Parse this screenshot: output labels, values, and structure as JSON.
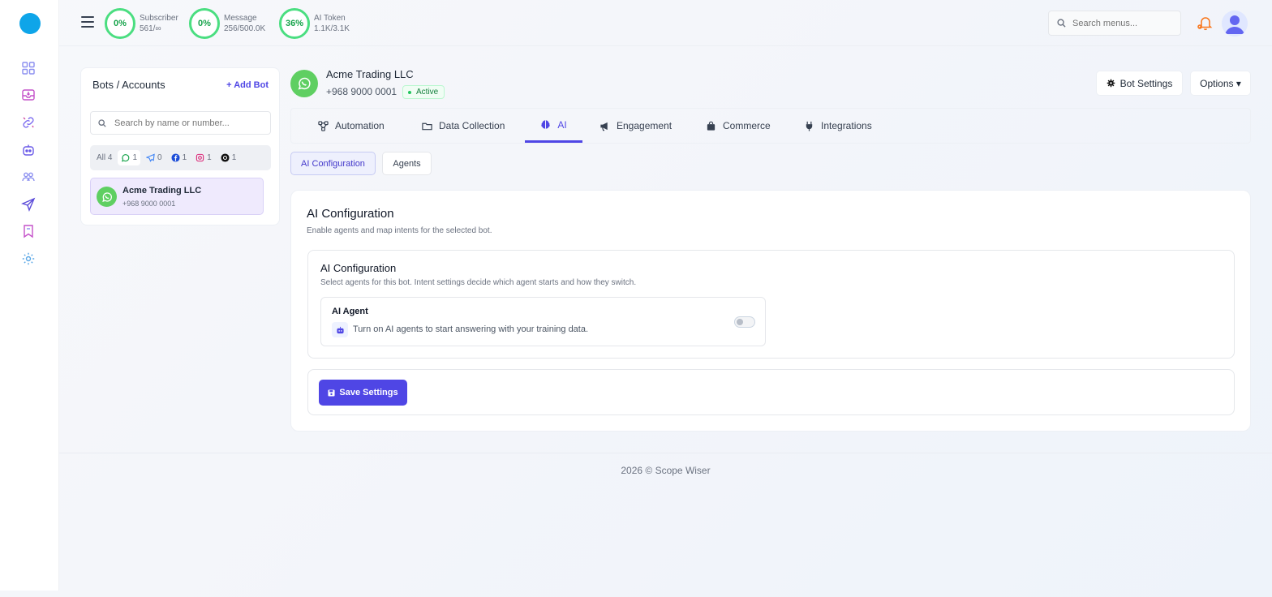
{
  "topbar": {
    "stats": [
      {
        "percent": "0%",
        "label": "Subscriber",
        "value": "561/∞"
      },
      {
        "percent": "0%",
        "label": "Message",
        "value": "256/500.0K"
      },
      {
        "percent": "36%",
        "label": "AI Token",
        "value": "1.1K/3.1K"
      }
    ],
    "search_placeholder": "Search menus..."
  },
  "bots_panel": {
    "title": "Bots / Accounts",
    "add_label": "+ Add Bot",
    "search_placeholder": "Search by name or number...",
    "filters": {
      "all": "All 4",
      "whatsapp": "1",
      "telegram": "0",
      "facebook": "1",
      "instagram": "1",
      "threads": "1"
    },
    "items": [
      {
        "name": "Acme Trading LLC",
        "phone": "+968 9000 0001"
      }
    ]
  },
  "bot_header": {
    "name": "Acme Trading LLC",
    "phone": "+968 9000 0001",
    "status": "Active",
    "bot_settings_label": "Bot Settings",
    "options_label": "Options ▾"
  },
  "tabs": [
    {
      "label": "Automation",
      "icon": "flow-icon"
    },
    {
      "label": "Data Collection",
      "icon": "folder-icon"
    },
    {
      "label": "AI",
      "icon": "brain-icon",
      "active": true
    },
    {
      "label": "Engagement",
      "icon": "megaphone-icon"
    },
    {
      "label": "Commerce",
      "icon": "bag-icon"
    },
    {
      "label": "Integrations",
      "icon": "plug-icon"
    }
  ],
  "subtabs": [
    {
      "label": "AI Configuration",
      "active": true
    },
    {
      "label": "Agents"
    }
  ],
  "config": {
    "title": "AI Configuration",
    "subtitle": "Enable agents and map intents for the selected bot.",
    "inner_title": "AI Configuration",
    "inner_subtitle": "Select agents for this bot. Intent settings decide which agent starts and how they switch.",
    "agent_title": "AI Agent",
    "agent_desc": "Turn on AI agents to start answering with your training data.",
    "agent_enabled": false,
    "save_label": "Save Settings"
  },
  "footer": "2026 © Scope Wiser",
  "colors": {
    "accent": "#4f46e5",
    "whatsapp": "#5fcf62",
    "ring": "#4ade80",
    "logo": "#0ea5e9"
  }
}
